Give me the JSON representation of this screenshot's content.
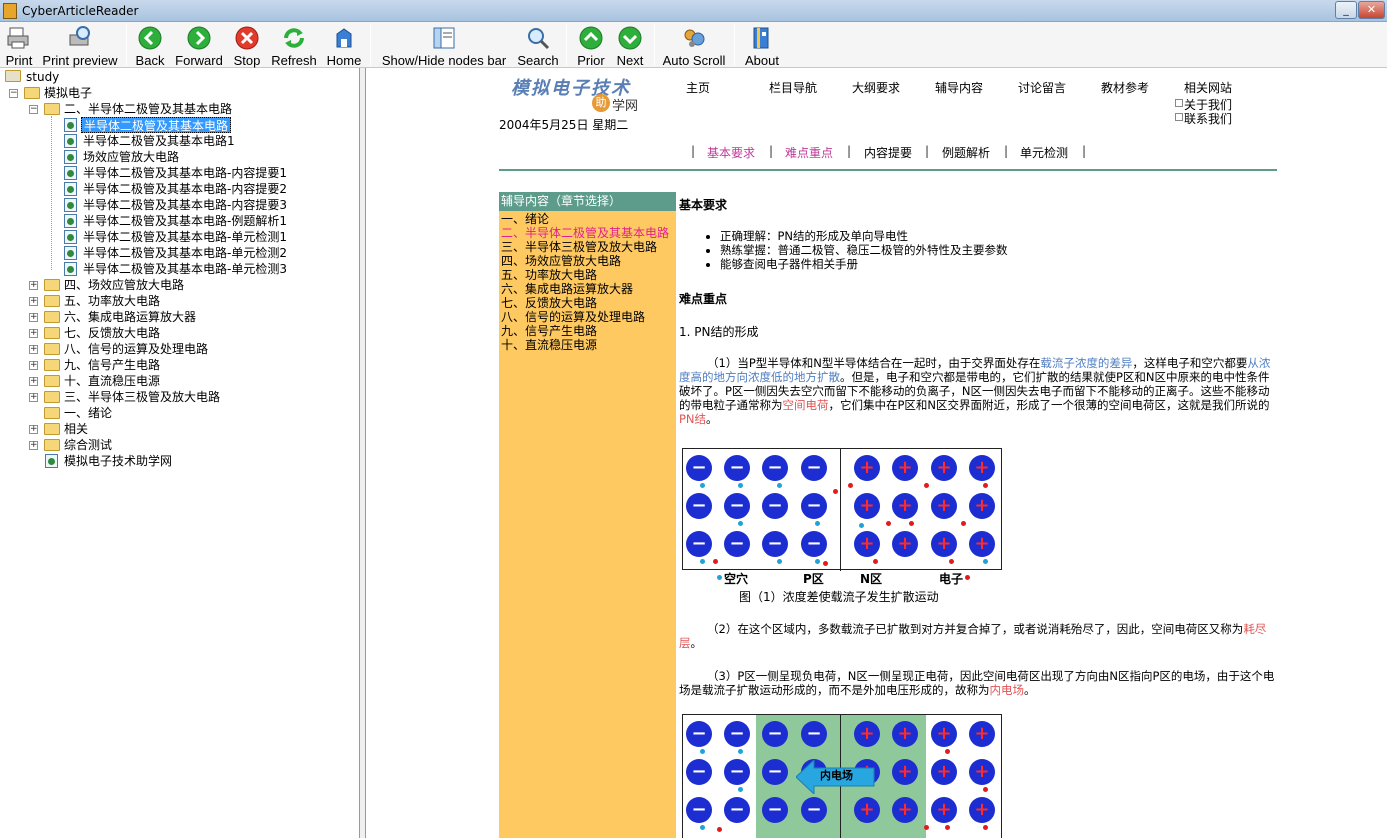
{
  "window": {
    "title": "CyberArticleReader"
  },
  "toolbar": {
    "print": "Print",
    "print_preview": "Print preview",
    "back": "Back",
    "forward": "Forward",
    "stop": "Stop",
    "refresh": "Refresh",
    "home": "Home",
    "nodes_bar": "Show/Hide nodes bar",
    "search": "Search",
    "prior": "Prior",
    "next": "Next",
    "auto_scroll": "Auto Scroll",
    "about": "About"
  },
  "tree": {
    "root": "study",
    "n1": "模拟电子",
    "n2": "二、半导体二极管及其基本电路",
    "leaves": [
      "半导体二极管及其基本电路",
      "半导体二极管及其基本电路1",
      "场效应管放大电路",
      "半导体二极管及其基本电路-内容提要1",
      "半导体二极管及其基本电路-内容提要2",
      "半导体二极管及其基本电路-内容提要3",
      "半导体二极管及其基本电路-例题解析1",
      "半导体二极管及其基本电路-单元检测1",
      "半导体二极管及其基本电路-单元检测2",
      "半导体二极管及其基本电路-单元检测3"
    ],
    "siblings": [
      "四、场效应管放大电路",
      "五、功率放大电路",
      "六、集成电路运算放大器",
      "七、反馈放大电路",
      "八、信号的运算及处理电路",
      "九、信号产生电路",
      "十、直流稳压电源",
      "三、半导体三极管及放大电路",
      "一、绪论"
    ],
    "related": "相关",
    "test": "综合测试",
    "site": "模拟电子技术助学网"
  },
  "site": {
    "logo": "模拟电子技术",
    "logo_ball": "助",
    "logo_rest": "学网",
    "date": "2004年5月25日  星期二",
    "nav": [
      "主页",
      "栏目导航",
      "大纲要求",
      "辅导内容",
      "讨论留言",
      "教材参考",
      "相关网站"
    ],
    "about_us": "关于我们",
    "contact_us": "联系我们",
    "subnav": [
      "基本要求",
      "难点重点",
      "内容提要",
      "例题解析",
      "单元检测"
    ]
  },
  "chapters": {
    "header": "辅导内容（章节选择）",
    "items": [
      "一、绪论",
      "二、半导体二极管及其基本电路",
      "三、半导体三极管及放大电路",
      "四、场效应管放大电路",
      "五、功率放大电路",
      "六、集成电路运算放大器",
      "七、反馈放大电路",
      "八、信号的运算及处理电路",
      "九、信号产生电路",
      "十、直流稳压电源"
    ]
  },
  "article": {
    "h1": "基本要求",
    "bullets": [
      "正确理解：PN结的形成及单向导电性",
      "熟练掌握：普通二极管、稳压二极管的外特性及主要参数",
      "能够查阅电子器件相关手册"
    ],
    "h2": "难点重点",
    "sec1": "1. PN结的形成",
    "p1_a": "（1）当P型半导体和N型半导体结合在一起时，由于交界面处存在",
    "p1_hl1": "载流子浓度的差异",
    "p1_b": "，这样电子和空穴都要",
    "p1_hl2": "从浓度高的地方向浓度低的地方扩散",
    "p1_c": "。但是，电子和空穴都是带电的，它们扩散的结果就使P区和N区中原来的电中性条件破坏了。P区一侧因失去空穴而留下不能移动的负离子，N区一侧因失去电子而留下不能移动的正离子。这些不能移动的带电粒子通常称为",
    "p1_red1": "空间电荷",
    "p1_d": "，它们集中在P区和N区交界面附近，形成了一个很薄的空间电荷区，这就是我们所说的",
    "p1_red2": "PN结",
    "p1_e": "。",
    "fig1_labels": [
      "空穴",
      "P区",
      "N区",
      "电子"
    ],
    "fig1_caption": "图（1）浓度差使载流子发生扩散运动",
    "p2_a": "（2）在这个区域内，多数载流子已扩散到对方并复合掉了，或者说消耗殆尽了，因此，空间电荷区又称为",
    "p2_red": "耗尽层",
    "p2_b": "。",
    "p3_a": "（3）P区一侧呈现负电荷，N区一侧呈现正电荷，因此空间电荷区出现了方向由N区指向P区的电场，由于这个电场是载流子扩散运动形成的，而不是外加电压形成的，故称为",
    "p3_red": "内电场",
    "p3_b": "。",
    "fig2_label": "内电场",
    "minus": "−",
    "plus": "+"
  }
}
